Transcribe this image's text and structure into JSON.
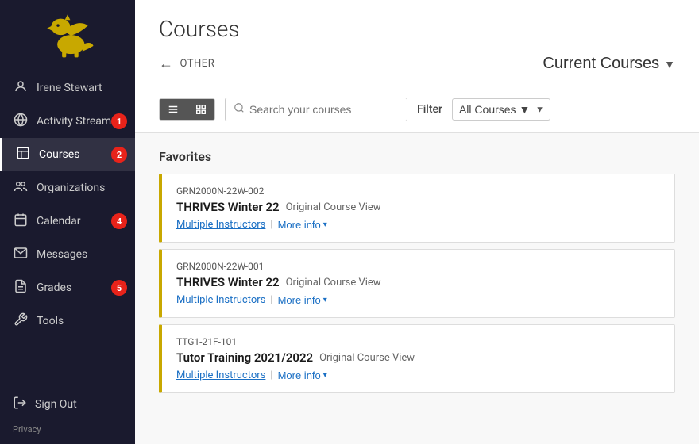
{
  "sidebar": {
    "items": [
      {
        "id": "user",
        "label": "Irene Stewart",
        "icon": "👤",
        "badge": null,
        "active": false
      },
      {
        "id": "activity-stream",
        "label": "Activity Stream",
        "icon": "🌐",
        "badge": "1",
        "active": false
      },
      {
        "id": "courses",
        "label": "Courses",
        "icon": "📋",
        "badge": "2",
        "active": true
      },
      {
        "id": "organizations",
        "label": "Organizations",
        "icon": "👥",
        "badge": null,
        "active": false
      },
      {
        "id": "calendar",
        "label": "Calendar",
        "icon": "📅",
        "badge": "4",
        "active": false
      },
      {
        "id": "messages",
        "label": "Messages",
        "icon": "✉️",
        "badge": null,
        "active": false
      },
      {
        "id": "grades",
        "label": "Grades",
        "icon": "📄",
        "badge": "5",
        "active": false
      },
      {
        "id": "tools",
        "label": "Tools",
        "icon": "🔧",
        "badge": null,
        "active": false
      }
    ],
    "signout_label": "Sign Out",
    "privacy_label": "Privacy"
  },
  "header": {
    "page_title": "Courses",
    "breadcrumb": "OTHER",
    "current_courses_label": "Current Courses"
  },
  "toolbar": {
    "list_view_label": "≡",
    "grid_view_label": "⊞",
    "search_placeholder": "Search your courses",
    "filter_label": "Filter",
    "filter_option": "All Courses"
  },
  "favorites": {
    "section_title": "Favorites",
    "courses": [
      {
        "code": "GRN2000N-22W-002",
        "name": "THRIVES Winter 22",
        "type": "Original Course View",
        "instructors": "Multiple Instructors",
        "more_label": "More info"
      },
      {
        "code": "GRN2000N-22W-001",
        "name": "THRIVES Winter 22",
        "type": "Original Course View",
        "instructors": "Multiple Instructors",
        "more_label": "More info"
      },
      {
        "code": "TTG1-21F-101",
        "name": "Tutor Training 2021/2022",
        "type": "Original Course View",
        "instructors": "Multiple Instructors",
        "more_label": "More info"
      }
    ]
  },
  "badges": {
    "activity_stream": "1",
    "courses": "2",
    "calendar": "4",
    "grades": "5"
  }
}
